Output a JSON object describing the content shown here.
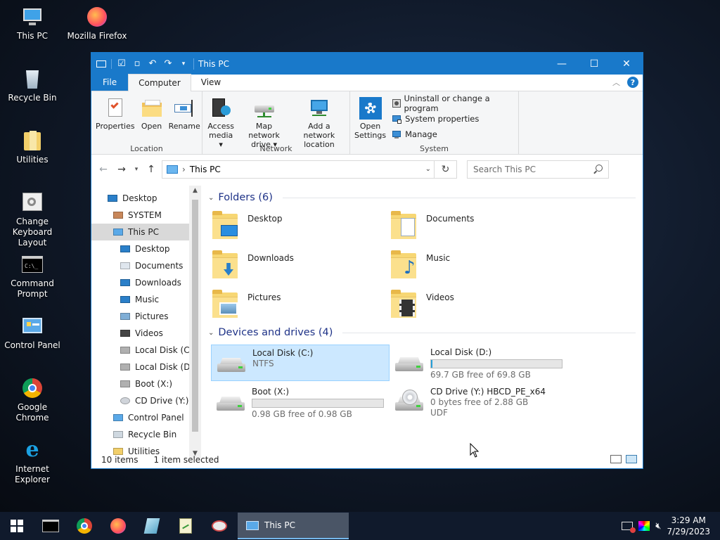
{
  "desktop": {
    "icons": [
      {
        "label": "This PC"
      },
      {
        "label": "Mozilla Firefox"
      },
      {
        "label": "Recycle Bin"
      },
      {
        "label": "Utilities"
      },
      {
        "label": "Change Keyboard Layout"
      },
      {
        "label": "Command Prompt"
      },
      {
        "label": "Control Panel"
      },
      {
        "label": "Google Chrome"
      },
      {
        "label": "Internet Explorer"
      }
    ]
  },
  "window": {
    "title": "This PC",
    "controls": {
      "minimize": "—",
      "maximize": "☐",
      "close": "✕"
    }
  },
  "ribbon": {
    "tabs": [
      {
        "label": "File"
      },
      {
        "label": "Computer"
      },
      {
        "label": "View"
      }
    ],
    "help": "?",
    "groups": {
      "location": {
        "name": "Location",
        "buttons": [
          {
            "label": "Properties"
          },
          {
            "label": "Open"
          },
          {
            "label": "Rename"
          }
        ]
      },
      "network": {
        "name": "Network",
        "buttons": [
          {
            "line1": "Access",
            "line2": "media ▾"
          },
          {
            "line1": "Map network",
            "line2": "drive ▾"
          },
          {
            "line1": "Add a network",
            "line2": "location"
          }
        ]
      },
      "system": {
        "name": "System",
        "open_settings": {
          "line1": "Open",
          "line2": "Settings"
        },
        "items": [
          {
            "label": "Uninstall or change a program"
          },
          {
            "label": "System properties"
          },
          {
            "label": "Manage"
          }
        ]
      }
    }
  },
  "address": {
    "path": "This PC",
    "separator": "›",
    "search_placeholder": "Search This PC"
  },
  "nav": {
    "items": [
      {
        "label": "Desktop",
        "indent": 1
      },
      {
        "label": "SYSTEM",
        "indent": 2
      },
      {
        "label": "This PC",
        "indent": 2,
        "selected": true
      },
      {
        "label": "Desktop",
        "indent": 3
      },
      {
        "label": "Documents",
        "indent": 3
      },
      {
        "label": "Downloads",
        "indent": 3
      },
      {
        "label": "Music",
        "indent": 3
      },
      {
        "label": "Pictures",
        "indent": 3
      },
      {
        "label": "Videos",
        "indent": 3
      },
      {
        "label": "Local Disk (C:)",
        "indent": 3
      },
      {
        "label": "Local Disk (D:)",
        "indent": 3
      },
      {
        "label": "Boot (X:)",
        "indent": 3
      },
      {
        "label": "CD Drive (Y:) H",
        "indent": 3
      },
      {
        "label": "Control Panel",
        "indent": 2
      },
      {
        "label": "Recycle Bin",
        "indent": 2
      },
      {
        "label": "Utilities",
        "indent": 2
      }
    ]
  },
  "folders": {
    "heading": "Folders (6)",
    "items": [
      {
        "label": "Desktop"
      },
      {
        "label": "Documents"
      },
      {
        "label": "Downloads"
      },
      {
        "label": "Music"
      },
      {
        "label": "Pictures"
      },
      {
        "label": "Videos"
      }
    ]
  },
  "drives": {
    "heading": "Devices and drives (4)",
    "items": [
      {
        "label": "Local Disk (C:)",
        "detail": "NTFS",
        "selected": true
      },
      {
        "label": "Local Disk (D:)",
        "free": "69.7 GB free of 69.8 GB",
        "used_fraction": 0.01
      },
      {
        "label": "Boot (X:)",
        "free": "0.98 GB free of 0.98 GB",
        "used_fraction": 0.0
      },
      {
        "label": "CD Drive (Y:) HBCD_PE_x64",
        "free": "0 bytes free of 2.88 GB",
        "detail": "UDF"
      }
    ]
  },
  "status": {
    "count": "10 items",
    "selected": "1 item selected"
  },
  "taskbar": {
    "active_window": "This PC",
    "time": "3:29 AM",
    "date": "7/29/2023"
  },
  "colors": {
    "accent": "#1979ca",
    "selection": "#cce8ff",
    "folder": "#f7d774"
  }
}
